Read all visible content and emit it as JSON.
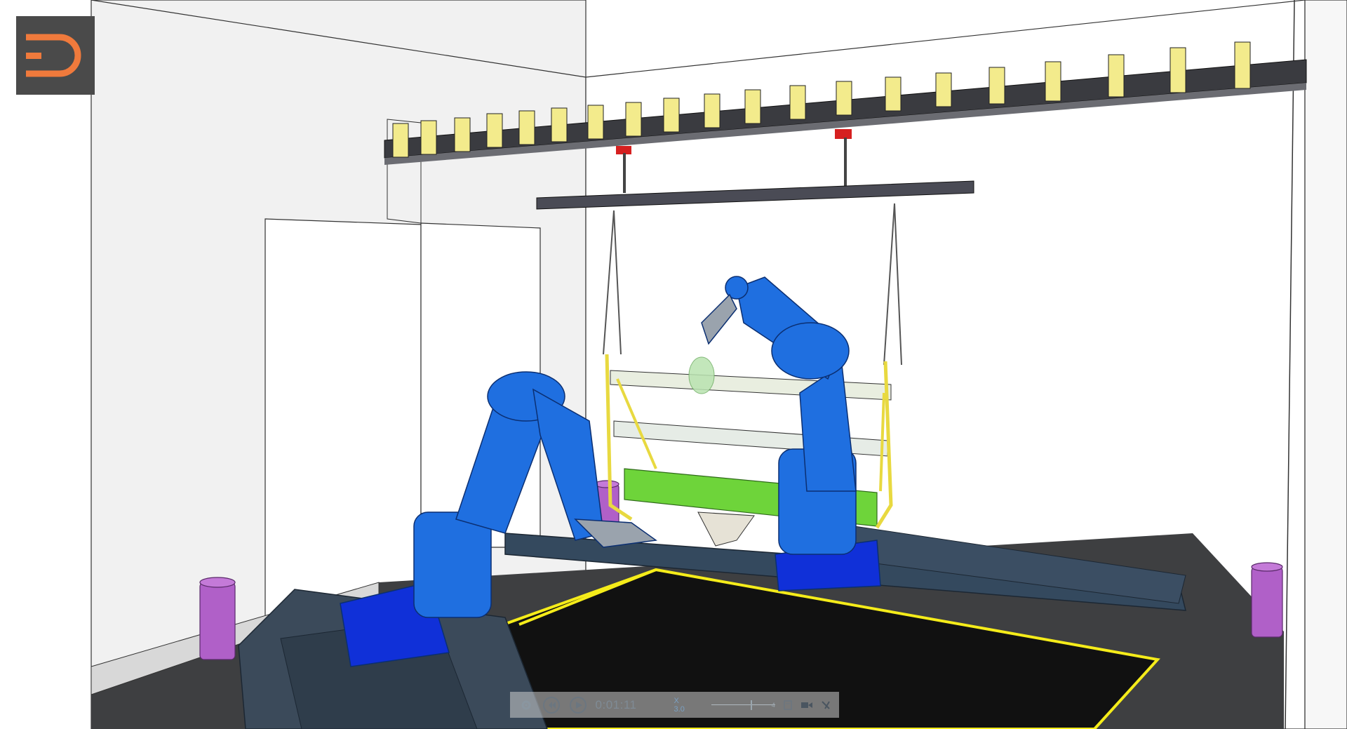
{
  "app": {
    "logo": {
      "icon": "dassault-d-logo-icon",
      "bg_color": "#4a4a4a",
      "accent_color": "#f07a3c"
    }
  },
  "scene": {
    "description_icon": "robot-cell-3d-viewport",
    "colors": {
      "robot": "#1f6fe0",
      "robot_base": "#1030d8",
      "rail": "#3b4a5a",
      "floor": "#3e3f41",
      "wall": "#f2f2f2",
      "conveyor_hanger": "#f3eb8c",
      "conveyor_beam": "#3a3b40",
      "part_highlight": "#6ed43a",
      "safety_line": "#f5ec1a",
      "drum": "#b060c8"
    }
  },
  "playback": {
    "settings_icon": "gear-icon",
    "rewind_icon": "skip-back-icon",
    "play_icon": "play-icon",
    "time": "0:01:11",
    "speed": "X 3.0",
    "slider_end": "4",
    "pdf_icon": "pdf-export-icon",
    "record_icon": "video-camera-icon",
    "share_icon": "share-icon"
  }
}
